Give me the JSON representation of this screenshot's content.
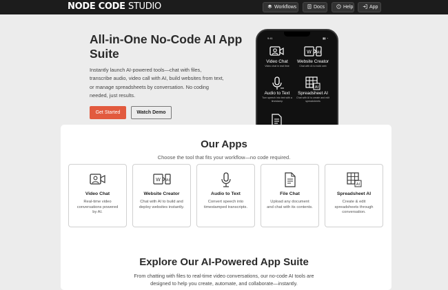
{
  "header": {
    "brand_bold": "NODE CODE",
    "brand_light": "STUDIO",
    "nav": [
      {
        "label": "Workflows",
        "icon": "layers-icon"
      },
      {
        "label": "Docs",
        "icon": "document-icon"
      },
      {
        "label": "Help",
        "icon": "question-icon"
      },
      {
        "label": "App",
        "icon": "sign-in-icon"
      }
    ]
  },
  "hero": {
    "title": "All-in-One No-Code AI App Suite",
    "description": "Instantly launch AI-powered tools—chat with files, transcribe audio, video call with AI, build websites from text, or manage spreadsheets by conversation. No coding needed, just results.",
    "primary_label": "Get Started",
    "secondary_label": "Watch Demo"
  },
  "phone": {
    "time": "9:41",
    "status": "▮▮ ◔",
    "apps": [
      {
        "name": "Video Chat",
        "desc": "Video chat in real time",
        "icon": "video-chat-icon"
      },
      {
        "name": "Website Creator",
        "desc": "Chat with AI to build web",
        "icon": "website-creator-icon"
      },
      {
        "name": "Audio to Text",
        "desc": "Turn speech into text with a timestamp",
        "icon": "microphone-icon"
      },
      {
        "name": "Spreadsheet AI",
        "desc": "Chat with AI to create and edit spreadsheets",
        "icon": "spreadsheet-icon"
      },
      {
        "name": "",
        "desc": "",
        "icon": "file-chat-icon"
      }
    ]
  },
  "apps_section": {
    "title": "Our Apps",
    "subtitle": "Choose the tool that fits your workflow—no code required.",
    "items": [
      {
        "name": "Video Chat",
        "desc": "Real-time video conversations powered by AI.",
        "icon": "video-chat-icon"
      },
      {
        "name": "Website Creator",
        "desc": "Chat with AI to build and deploy websites instantly.",
        "icon": "website-creator-icon"
      },
      {
        "name": "Audio to Text",
        "desc": "Convert speech into timestamped transcripts.",
        "icon": "microphone-icon"
      },
      {
        "name": "File Chat",
        "desc": "Upload any document and chat with its contents.",
        "icon": "file-chat-icon"
      },
      {
        "name": "Spreadsheet AI",
        "desc": "Create & edit spreadsheets through conversation.",
        "icon": "spreadsheet-icon"
      }
    ]
  },
  "explore": {
    "title": "Explore Our AI-Powered App Suite",
    "description": "From chatting with files to real-time video conversations, our no-code AI tools are designed to help you create, automate, and collaborate—instantly."
  }
}
